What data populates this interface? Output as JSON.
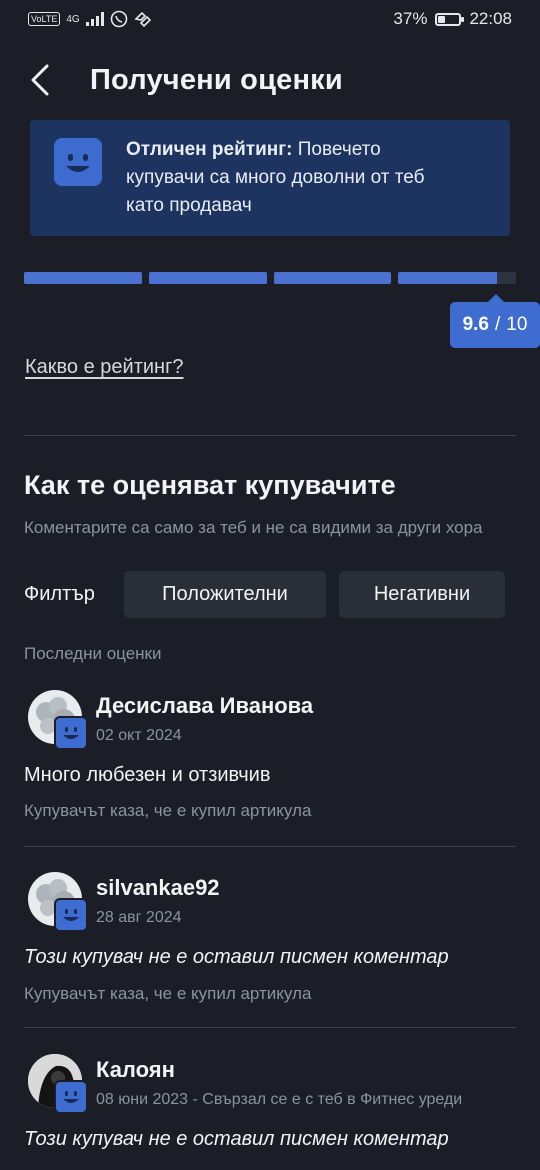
{
  "status": {
    "network_badge": "VoLTE",
    "network_type": "4G",
    "battery_percent": "37%",
    "battery_level": 0.37,
    "time": "22:08"
  },
  "header": {
    "title": "Получени оценки"
  },
  "rating_card": {
    "title": "Отличен рейтинг:",
    "line1": " Повечето",
    "line2": "купувачи са много доволни от теб",
    "line3": "като продавач"
  },
  "score": {
    "value": "9.6",
    "separator": "/",
    "max": "10",
    "value_num": 9.6,
    "max_num": 10
  },
  "what_is_rating": "Какво е рейтинг?",
  "section": {
    "title": "Как те оценяват купувачите",
    "subtitle": "Коментарите са само за теб и не са видими за други хора"
  },
  "filter": {
    "label": "Филтър",
    "options": [
      "Положителни",
      "Негативни"
    ]
  },
  "recent_label": "Последни оценки",
  "reviews": [
    {
      "name": "Десислава Иванова",
      "date": "02 окт 2024",
      "text": "Много любезен и отзивчив",
      "italic": false,
      "note": "Купувачът каза, че е купил артикула"
    },
    {
      "name": "silvankae92",
      "date": "28 авг 2024",
      "text": "Този купувач не е оставил писмен коментар",
      "italic": true,
      "note": "Купувачът каза, че е купил артикула"
    },
    {
      "name": "Калоян",
      "date": "08 юни 2023 - Свързал се е с теб в Фитнес уреди",
      "text": "Този купувач не е оставил писмен коментар",
      "italic": true,
      "note": ""
    }
  ],
  "colors": {
    "background": "#1b1e27",
    "accent": "#3f6cd1",
    "card": "#1d3461"
  }
}
